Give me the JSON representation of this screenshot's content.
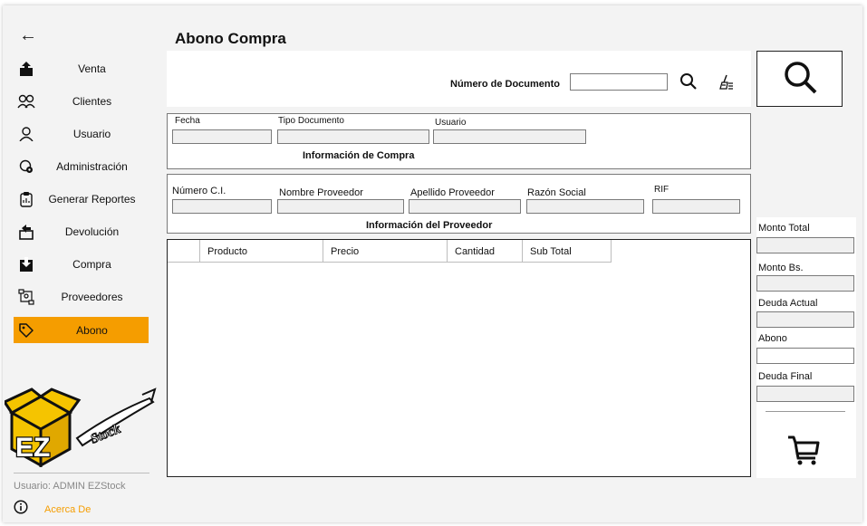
{
  "sidebar": {
    "back_glyph": "←",
    "items": [
      {
        "label": "Venta",
        "icon": "upload-box-icon"
      },
      {
        "label": "Clientes",
        "icon": "people-icon"
      },
      {
        "label": "Usuario",
        "icon": "person-icon"
      },
      {
        "label": "Administración",
        "icon": "admin-gear-icon"
      },
      {
        "label": "Generar Reportes",
        "icon": "clipboard-icon"
      },
      {
        "label": "Devolución",
        "icon": "return-box-icon"
      },
      {
        "label": "Compra",
        "icon": "download-box-icon"
      },
      {
        "label": "Proveedores",
        "icon": "supplier-network-icon"
      },
      {
        "label": "Abono",
        "icon": "tag-icon",
        "active": true
      }
    ],
    "logo_text": "EZStock",
    "user_line": "Usuario: ADMIN EZStock",
    "about_label": "Acerca De"
  },
  "header": {
    "title": "Abono Compra"
  },
  "search": {
    "doc_label": "Número de Documento",
    "doc_value": ""
  },
  "purchase_info": {
    "title": "Información de Compra",
    "fields": [
      {
        "label": "Fecha",
        "value": ""
      },
      {
        "label": "Tipo Documento",
        "value": ""
      },
      {
        "label": "Usuario",
        "value": ""
      }
    ]
  },
  "supplier_info": {
    "title": "Información del Proveedor",
    "fields": [
      {
        "label": "Número C.I.",
        "value": ""
      },
      {
        "label": "Nombre Proveedor",
        "value": ""
      },
      {
        "label": "Apellido Proveedor",
        "value": ""
      },
      {
        "label": "Razón Social",
        "value": ""
      },
      {
        "label": "RIF",
        "value": ""
      }
    ]
  },
  "table": {
    "columns": [
      "",
      "Producto",
      "Precio",
      "Cantidad",
      "Sub Total"
    ],
    "rows": []
  },
  "totals": {
    "monto_total_label": "Monto Total",
    "monto_total_value": "",
    "monto_bs_label": "Monto Bs.",
    "monto_bs_value": "",
    "deuda_actual_label": "Deuda Actual",
    "deuda_actual_value": "",
    "abono_label": "Abono",
    "abono_value": "",
    "deuda_final_label": "Deuda Final",
    "deuda_final_value": ""
  },
  "colors": {
    "accent": "#f59d00",
    "background": "#f3f3f3"
  }
}
